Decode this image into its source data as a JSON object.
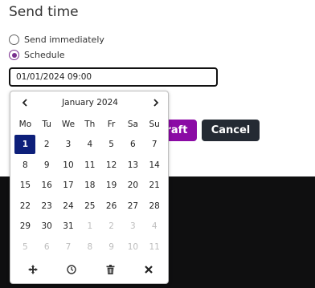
{
  "form": {
    "title": "Send time",
    "radio_send_now": "Send immediately",
    "radio_schedule": "Schedule",
    "datetime_value": "01/01/2024 09:00",
    "draft_button_partial": "raft",
    "cancel_button": "Cancel"
  },
  "calendar": {
    "month_label": "January 2024",
    "weekdays": [
      "Mo",
      "Tu",
      "We",
      "Th",
      "Fr",
      "Sa",
      "Su"
    ],
    "weeks": [
      [
        {
          "d": "1",
          "muted": false,
          "selected": true
        },
        {
          "d": "2"
        },
        {
          "d": "3"
        },
        {
          "d": "4"
        },
        {
          "d": "5"
        },
        {
          "d": "6"
        },
        {
          "d": "7"
        }
      ],
      [
        {
          "d": "8"
        },
        {
          "d": "9"
        },
        {
          "d": "10"
        },
        {
          "d": "11"
        },
        {
          "d": "12"
        },
        {
          "d": "13"
        },
        {
          "d": "14"
        }
      ],
      [
        {
          "d": "15"
        },
        {
          "d": "16"
        },
        {
          "d": "17"
        },
        {
          "d": "18"
        },
        {
          "d": "19"
        },
        {
          "d": "20"
        },
        {
          "d": "21"
        }
      ],
      [
        {
          "d": "22"
        },
        {
          "d": "23"
        },
        {
          "d": "24"
        },
        {
          "d": "25"
        },
        {
          "d": "26"
        },
        {
          "d": "27"
        },
        {
          "d": "28"
        }
      ],
      [
        {
          "d": "29"
        },
        {
          "d": "30"
        },
        {
          "d": "31"
        },
        {
          "d": "1",
          "muted": true
        },
        {
          "d": "2",
          "muted": true
        },
        {
          "d": "3",
          "muted": true
        },
        {
          "d": "4",
          "muted": true
        }
      ],
      [
        {
          "d": "5",
          "muted": true
        },
        {
          "d": "6",
          "muted": true
        },
        {
          "d": "7",
          "muted": true
        },
        {
          "d": "8",
          "muted": true
        },
        {
          "d": "9",
          "muted": true
        },
        {
          "d": "10",
          "muted": true
        },
        {
          "d": "11",
          "muted": true
        }
      ]
    ],
    "tools": [
      "move-icon",
      "clock-icon",
      "trash-icon",
      "close-icon"
    ]
  },
  "colors": {
    "accent": "#8b0aa5",
    "selected_day": "#0d1f7a",
    "cancel": "#242a33"
  }
}
